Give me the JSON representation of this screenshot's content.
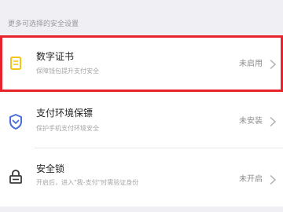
{
  "section": {
    "title": "更多可选择的安全设置"
  },
  "rows": [
    {
      "title": "数字证书",
      "subtitle": "保障钱包提升支付安全",
      "status": "未启用",
      "icon": "certificate-icon"
    },
    {
      "title": "支付环境保镖",
      "subtitle": "保护手机支付环境安全",
      "status": "未安装",
      "icon": "shield-icon"
    },
    {
      "title": "安全锁",
      "subtitle": "开启后，进入\"我-支付\"时需验证身份",
      "status": "未开启",
      "icon": "lock-icon"
    }
  ],
  "colors": {
    "highlight_border": "#e8232b",
    "icon_yellow": "#f5c518",
    "icon_blue": "#4a6fd9",
    "icon_gray": "#3a3a3a"
  }
}
